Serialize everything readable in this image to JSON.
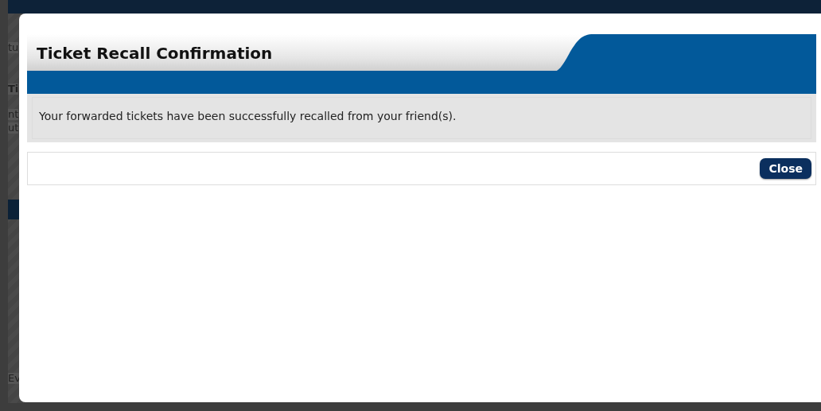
{
  "background_fragments": [
    "tu",
    "Ti",
    "nt",
    "ut",
    "Ev"
  ],
  "dialog": {
    "title": "Ticket Recall Confirmation",
    "message": "Your forwarded tickets have been successfully recalled from your friend(s).",
    "buttons": [
      {
        "label": "Close"
      }
    ]
  }
}
